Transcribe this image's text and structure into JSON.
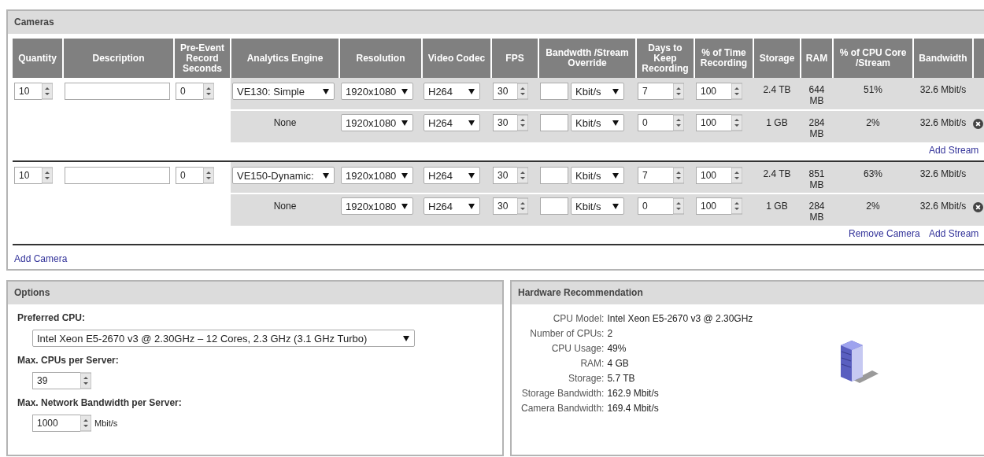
{
  "cameras_panel": {
    "title": "Cameras",
    "columns": [
      "Quantity",
      "Description",
      "Pre-Event Record Seconds",
      "Analytics Engine",
      "Resolution",
      "Video Codec",
      "FPS",
      "Bandwdth /Stream Override",
      "Days to Keep Recording",
      "% of Time Recording",
      "Storage",
      "RAM",
      "% of CPU Core /Stream",
      "Bandwidth"
    ],
    "cameras": [
      {
        "quantity": "10",
        "pre_event": "0",
        "streams": [
          {
            "analytics": {
              "kind": "dropdown",
              "value": "VE130: Simple"
            },
            "resolution": "1920x1080",
            "codec": "H264",
            "fps": "30",
            "bandwidth_unit": "Kbit/s",
            "days": "7",
            "time_pct": "100",
            "storage": "2.4 TB",
            "ram": "644 MB",
            "cpu_pct": "51%",
            "bandwidth": "32.6 Mbit/s",
            "removable": false
          },
          {
            "analytics": {
              "kind": "text",
              "value": "None"
            },
            "resolution": "1920x1080",
            "codec": "H264",
            "fps": "30",
            "bandwidth_unit": "Kbit/s",
            "days": "0",
            "time_pct": "100",
            "storage": "1 GB",
            "ram": "284 MB",
            "cpu_pct": "2%",
            "bandwidth": "32.6 Mbit/s",
            "removable": true
          }
        ],
        "links": [
          {
            "kind": "add_stream",
            "label": "Add Stream"
          }
        ]
      },
      {
        "quantity": "10",
        "pre_event": "0",
        "streams": [
          {
            "analytics": {
              "kind": "dropdown",
              "value": "VE150-Dynamic:"
            },
            "resolution": "1920x1080",
            "codec": "H264",
            "fps": "30",
            "bandwidth_unit": "Kbit/s",
            "days": "7",
            "time_pct": "100",
            "storage": "2.4 TB",
            "ram": "851 MB",
            "cpu_pct": "63%",
            "bandwidth": "32.6 Mbit/s",
            "removable": false
          },
          {
            "analytics": {
              "kind": "text",
              "value": "None"
            },
            "resolution": "1920x1080",
            "codec": "H264",
            "fps": "30",
            "bandwidth_unit": "Kbit/s",
            "days": "0",
            "time_pct": "100",
            "storage": "1 GB",
            "ram": "284 MB",
            "cpu_pct": "2%",
            "bandwidth": "32.6 Mbit/s",
            "removable": true
          }
        ],
        "links": [
          {
            "kind": "remove_camera",
            "label": "Remove Camera"
          },
          {
            "kind": "add_stream",
            "label": "Add Stream"
          }
        ]
      }
    ],
    "add_camera": "Add Camera"
  },
  "options_panel": {
    "title": "Options",
    "fields": [
      {
        "kind": "select",
        "label": "Preferred CPU:",
        "value": "Intel Xeon E5-2670 v3 @ 2.30GHz – 12 Cores, 2.3 GHz (3.1 GHz Turbo)"
      },
      {
        "kind": "spin",
        "label": "Max. CPUs per Server:",
        "value": "39"
      },
      {
        "kind": "spin",
        "label": "Max. Network Bandwidth per Server:",
        "value": "1000",
        "unit": "Mbit/s"
      }
    ]
  },
  "hardware_panel": {
    "title": "Hardware Recommendation",
    "specs": [
      {
        "label": "CPU Model:",
        "value": "Intel Xeon E5-2670 v3 @ 2.30GHz"
      },
      {
        "label": "Number of CPUs:",
        "value": "2"
      },
      {
        "label": "CPU Usage:",
        "value": "49%"
      },
      {
        "label": "RAM:",
        "value": "4 GB"
      },
      {
        "label": "Storage:",
        "value": "5.7 TB"
      },
      {
        "label": "Storage Bandwidth:",
        "value": "162.9 Mbit/s"
      },
      {
        "label": "Camera Bandwidth:",
        "value": "169.4 Mbit/s"
      }
    ]
  }
}
